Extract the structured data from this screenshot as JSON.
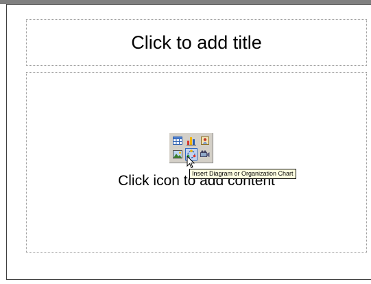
{
  "slide": {
    "title_placeholder": "Click to add title",
    "content_placeholder": "Click icon to add content"
  },
  "content_icons": [
    {
      "name": "insert-table-icon"
    },
    {
      "name": "insert-chart-icon"
    },
    {
      "name": "insert-clip-art-icon"
    },
    {
      "name": "insert-picture-icon"
    },
    {
      "name": "insert-diagram-icon"
    },
    {
      "name": "insert-media-clip-icon"
    }
  ],
  "tooltip": {
    "text": "Insert Diagram or Organization Chart"
  },
  "colors": {
    "tooltip_bg": "#ffffe1",
    "placeholder_border": "#9a9a9a",
    "palette_bg": "#d4d0c8",
    "hover_highlight": "#316ac5"
  }
}
